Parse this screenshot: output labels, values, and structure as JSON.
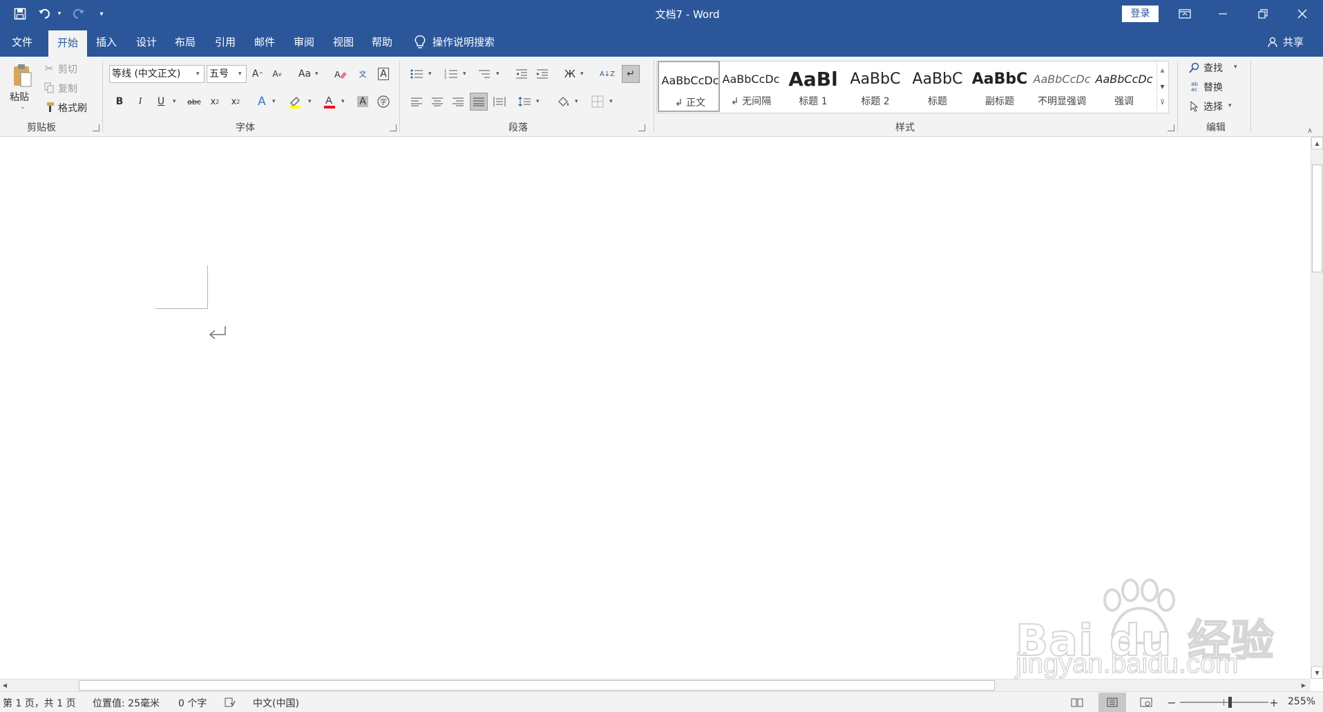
{
  "title_bar": {
    "doc_title": "文档7",
    "separator": "-",
    "app_name": "Word",
    "login_label": "登录"
  },
  "tabs": [
    {
      "label": "文件"
    },
    {
      "label": "开始"
    },
    {
      "label": "插入"
    },
    {
      "label": "设计"
    },
    {
      "label": "布局"
    },
    {
      "label": "引用"
    },
    {
      "label": "邮件"
    },
    {
      "label": "审阅"
    },
    {
      "label": "视图"
    },
    {
      "label": "帮助"
    }
  ],
  "tell_me": "操作说明搜索",
  "share_label": "共享",
  "clipboard": {
    "paste_label": "粘贴",
    "cut_label": "剪切",
    "copy_label": "复制",
    "format_painter_label": "格式刷",
    "group_label": "剪贴板"
  },
  "font": {
    "font_name": "等线 (中文正文)",
    "font_size": "五号",
    "group_label": "字体",
    "change_case_label": "Aa"
  },
  "paragraph": {
    "group_label": "段落"
  },
  "styles": {
    "group_label": "样式",
    "items": [
      {
        "preview": "AaBbCcDc",
        "name": "正文"
      },
      {
        "preview": "AaBbCcDc",
        "name": "无间隔"
      },
      {
        "preview": "AaBl",
        "name": "标题 1"
      },
      {
        "preview": "AaBbC",
        "name": "标题 2"
      },
      {
        "preview": "AaBbC",
        "name": "标题"
      },
      {
        "preview": "AaBbC",
        "name": "副标题"
      },
      {
        "preview": "AaBbCcDc",
        "name": "不明显强调"
      },
      {
        "preview": "AaBbCcDc",
        "name": "强调"
      }
    ]
  },
  "editing": {
    "find_label": "查找",
    "replace_label": "替换",
    "select_label": "选择",
    "group_label": "编辑"
  },
  "status": {
    "page": "第 1 页，共 1 页",
    "position": "位置值: 25毫米",
    "words": "0 个字",
    "language": "中文(中国)",
    "zoom": "255%",
    "zoom_level": 0.4
  },
  "watermark": {
    "logo_text": "Bai du 经验",
    "url": "jingyan.baidu.com"
  }
}
